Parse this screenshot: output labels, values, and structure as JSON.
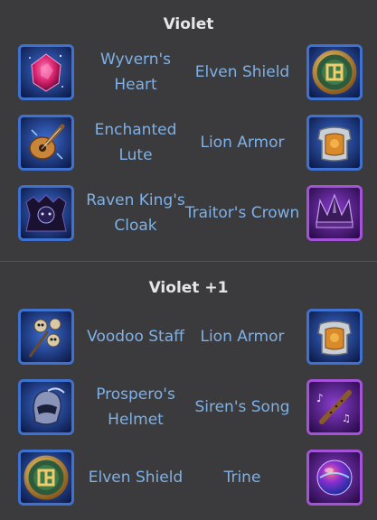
{
  "sections": [
    {
      "title": "Violet",
      "rows": [
        {
          "left": {
            "name": "Wyvern's Heart",
            "icon": "wyverns-heart-icon",
            "frame": "blue"
          },
          "right": {
            "name": "Elven Shield",
            "icon": "elven-shield-icon",
            "frame": "blue"
          }
        },
        {
          "left": {
            "name": "Enchanted Lute",
            "icon": "enchanted-lute-icon",
            "frame": "blue"
          },
          "right": {
            "name": "Lion Armor",
            "icon": "lion-armor-icon",
            "frame": "blue"
          }
        },
        {
          "left": {
            "name": "Raven King's Cloak",
            "icon": "raven-kings-cloak-icon",
            "frame": "blue"
          },
          "right": {
            "name": "Traitor's Crown",
            "icon": "traitors-crown-icon",
            "frame": "purple"
          }
        }
      ]
    },
    {
      "title": "Violet +1",
      "rows": [
        {
          "left": {
            "name": "Voodoo Staff",
            "icon": "voodoo-staff-icon",
            "frame": "blue"
          },
          "right": {
            "name": "Lion Armor",
            "icon": "lion-armor-icon",
            "frame": "blue"
          }
        },
        {
          "left": {
            "name": "Prospero's Helmet",
            "icon": "prosperos-helmet-icon",
            "frame": "blue"
          },
          "right": {
            "name": "Siren's Song",
            "icon": "sirens-song-icon",
            "frame": "purple"
          }
        },
        {
          "left": {
            "name": "Elven Shield",
            "icon": "elven-shield-icon",
            "frame": "blue"
          },
          "right": {
            "name": "Trine",
            "icon": "trine-icon",
            "frame": "purple"
          }
        }
      ]
    }
  ],
  "colors": {
    "background": "#3b3b3d",
    "title": "#e6e6e6",
    "item_text": "#7fb0e6",
    "frame_blue": "#3f72cf",
    "frame_purple": "#a453d8"
  }
}
